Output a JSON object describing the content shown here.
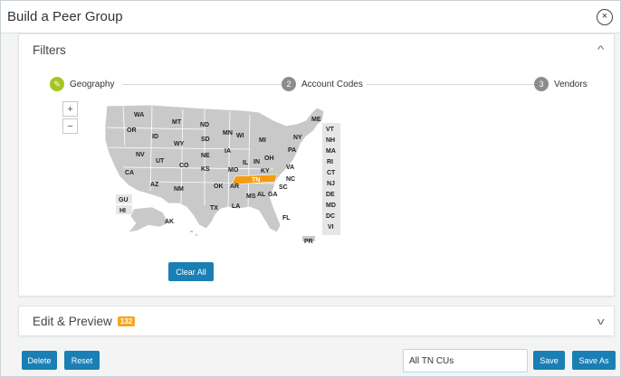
{
  "modal": {
    "title": "Build a Peer Group",
    "close_label": "×"
  },
  "filters": {
    "title": "Filters",
    "collapse_chevron": "^"
  },
  "steps": [
    {
      "number": "✎",
      "label": "Geography",
      "state": "done"
    },
    {
      "number": "2",
      "label": "Account Codes",
      "state": "todo"
    },
    {
      "number": "3",
      "label": "Vendors",
      "state": "todo"
    }
  ],
  "map": {
    "zoom_in": "+",
    "zoom_out": "−",
    "selected_state": "TN",
    "selected_color": "#f39c12",
    "state_color": "#c9c9c9",
    "labels": {
      "WA": "WA",
      "OR": "OR",
      "CA": "CA",
      "NV": "NV",
      "ID": "ID",
      "MT": "MT",
      "WY": "WY",
      "UT": "UT",
      "AZ": "AZ",
      "CO": "CO",
      "NM": "NM",
      "ND": "ND",
      "SD": "SD",
      "NE": "NE",
      "KS": "KS",
      "OK": "OK",
      "TX": "TX",
      "MN": "MN",
      "IA": "IA",
      "MO": "MO",
      "AR": "AR",
      "LA": "LA",
      "WI": "WI",
      "IL": "IL",
      "MS": "MS",
      "MI": "MI",
      "IN": "IN",
      "KY": "KY",
      "TN": "TN",
      "AL": "AL",
      "OH": "OH",
      "GA": "GA",
      "FL": "FL",
      "SC": "SC",
      "NC": "NC",
      "VA": "VA",
      "PA": "PA",
      "NY": "NY",
      "ME": "ME",
      "AK": "AK",
      "PR": "PR"
    },
    "side_boxes": [
      "VT",
      "NH",
      "MA",
      "RI",
      "CT",
      "NJ",
      "DE",
      "MD",
      "DC",
      "VI"
    ],
    "territories": [
      "GU",
      "HI"
    ],
    "clear_all": "Clear All"
  },
  "edit_preview": {
    "title": "Edit & Preview",
    "count": "132",
    "chevron": "v"
  },
  "footer": {
    "delete": "Delete",
    "reset": "Reset",
    "name_value": "All TN CUs",
    "save": "Save",
    "save_as": "Save As"
  }
}
